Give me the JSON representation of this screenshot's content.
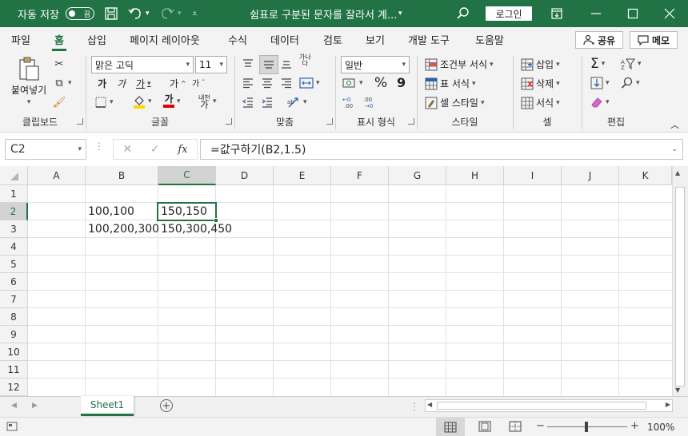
{
  "titlebar": {
    "autosave_label": "자동 저장",
    "autosave_state": "끔",
    "doc_title": "쉼표로 구분된 문자를 잘라서 계...",
    "login_label": "로그인",
    "icons": [
      "save-icon",
      "undo-icon",
      "redo-icon",
      "customize-icon",
      "search-icon",
      "ribbon-display-icon",
      "minimize-icon",
      "maximize-icon",
      "close-icon"
    ]
  },
  "menu": {
    "tabs": [
      "파일",
      "홈",
      "삽입",
      "페이지 레이아웃",
      "수식",
      "데이터",
      "검토",
      "보기",
      "개발 도구",
      "도움말"
    ],
    "active": "홈",
    "share_label": "공유",
    "memo_label": "메모"
  },
  "ribbon": {
    "clipboard": {
      "label": "클립보드",
      "paste": "붙여넣기"
    },
    "font": {
      "label": "글꼴",
      "name": "맑은 고딕",
      "size": "11",
      "bold": "가",
      "italic": "가",
      "underline": "가",
      "grow": "가",
      "shrink": "가",
      "fontcolor": "가",
      "phonetic_top": "내천",
      "phonetic_bottom": "가"
    },
    "align": {
      "label": "맞춤",
      "wrap_top": "가나",
      "wrap_bottom": "다"
    },
    "number": {
      "label": "표시 형식",
      "format": "일반",
      "percent": "%",
      "comma": "9"
    },
    "styles": {
      "label": "스타일",
      "cond": "조건부 서식",
      "table": "표 서식",
      "cell": "셀 스타일"
    },
    "cells": {
      "label": "셀",
      "insert": "삽입",
      "delete": "삭제",
      "format": "서식"
    },
    "editing": {
      "label": "편집"
    }
  },
  "formula_bar": {
    "name_box": "C2",
    "fx_label": "fx",
    "formula": "=값구하기(B2,1.5)"
  },
  "sheet": {
    "columns": [
      "A",
      "B",
      "C",
      "D",
      "E",
      "F",
      "G",
      "H",
      "I",
      "J",
      "K"
    ],
    "rows": [
      "1",
      "2",
      "3",
      "4",
      "5",
      "6",
      "7",
      "8",
      "9",
      "10",
      "11",
      "12"
    ],
    "selected_cell": "C2",
    "cells": {
      "B2": "100,100",
      "C2": "150,150",
      "B3": "100,200,300",
      "C3": "150,300,450"
    }
  },
  "sheet_tabs": {
    "active": "Sheet1",
    "add": "+"
  },
  "status": {
    "zoom": "100%",
    "zoom_minus": "−",
    "zoom_plus": "+"
  },
  "colors": {
    "accent": "#217346",
    "title_bg": "#217346",
    "ribbon_bg": "#f3f3f3"
  }
}
